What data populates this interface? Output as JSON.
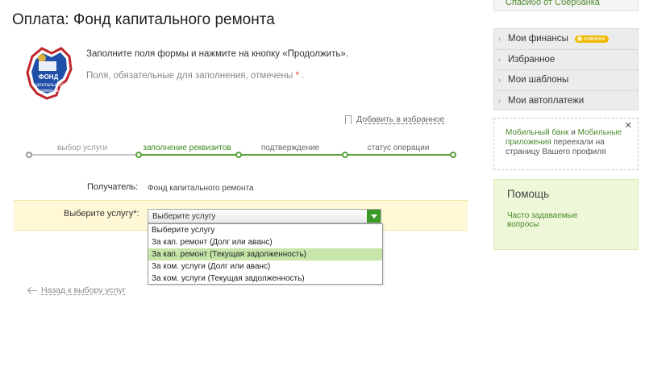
{
  "page": {
    "title": "Оплата: Фонд капитального ремонта",
    "logo_text": "Фонд капитального ремонта",
    "instruction": "Заполните поля формы и нажмите на кнопку «Продолжить».",
    "required_note": "Поля, обязательные для заполнения, отмечены",
    "required_star": "*",
    "required_end": ".",
    "favorite_label": "Добавить в избранное"
  },
  "steps": [
    {
      "label": "выбор услуги",
      "state": "done"
    },
    {
      "label": "заполнение реквизитов",
      "state": "active"
    },
    {
      "label": "подтверждение",
      "state": "next"
    },
    {
      "label": "статус операции",
      "state": "next"
    }
  ],
  "form": {
    "recipient_label": "Получатель:",
    "recipient_value": "Фонд капитального ремонта",
    "service_label": "Выберите услугу*:",
    "service_value": "Выберите услугу",
    "options": [
      "Выберите услугу",
      "За кап. ремонт (Долг или аванс)",
      "За кап. ремонт (Текущая задолженность)",
      "За ком. услуги (Долг или аванс)",
      "За ком. услуги (Текущая задолженность)"
    ],
    "highlighted_option_index": 2,
    "back_link": "Назад к выбору услуг"
  },
  "sidebar": {
    "thanks": "Спасибо от Сбербанка",
    "menu": [
      {
        "label": "Мои финансы",
        "badge": "новинка"
      },
      {
        "label": "Избранное"
      },
      {
        "label": "Мои шаблоны"
      },
      {
        "label": "Мои автоплатежи"
      }
    ],
    "notice": {
      "link1": "Мобильный банк",
      "and": "и",
      "link2": "Мобильные приложения",
      "rest": "переехали на страницу Вашего профиля"
    },
    "help": {
      "title": "Помощь",
      "link": "Часто задаваемые вопросы"
    }
  },
  "colors": {
    "accent_green": "#3c9b24",
    "link_green": "#4a8a2a",
    "highlight_row": "#fff8d6",
    "selected_option": "#c6e5a8",
    "badge": "#f1b800"
  }
}
